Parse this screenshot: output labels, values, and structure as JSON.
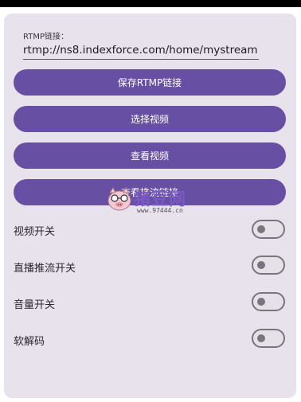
{
  "rtmp": {
    "label": "RTMP链接：",
    "value": "rtmp://ns8.indexforce.com/home/mystream"
  },
  "buttons": {
    "save": "保存RTMP链接",
    "select_video": "选择视频",
    "view_video": "查看视频",
    "fourth": "查看推流链接"
  },
  "toggles": [
    {
      "label": "视频开关",
      "on": false
    },
    {
      "label": "直播推流开关",
      "on": false
    },
    {
      "label": "音量开关",
      "on": false
    },
    {
      "label": "软解码",
      "on": false
    }
  ],
  "watermark": {
    "brand": "猪豆网",
    "url": "www.97444.cn"
  },
  "colors": {
    "primary": "#6750a4",
    "surface": "#e8e2ec",
    "outline": "#79747e"
  }
}
